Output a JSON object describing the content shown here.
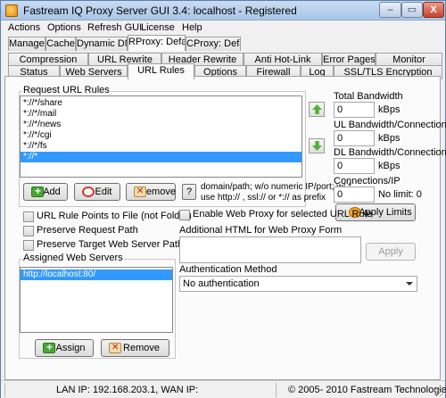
{
  "window": {
    "title": "Fastream IQ Proxy Server GUI 3.4: localhost - Registered",
    "min_label": "–",
    "max_label": "▭",
    "close_label": "X"
  },
  "menu": [
    {
      "label": "Actions"
    },
    {
      "label": "Options"
    },
    {
      "label": "Refresh GUI"
    },
    {
      "label": "License"
    },
    {
      "label": "Help"
    }
  ],
  "top_tabs": [
    {
      "label": "Manager"
    },
    {
      "label": "Cache"
    },
    {
      "label": "Dynamic DNS"
    },
    {
      "label": "RProxy: Default",
      "active": true
    },
    {
      "label": "CProxy: Default"
    }
  ],
  "sub_tabs_row1": [
    {
      "label": "Compression"
    },
    {
      "label": "URL Rewrite"
    },
    {
      "label": "Header Rewrite"
    },
    {
      "label": "Anti Hot-Link"
    },
    {
      "label": "Error Pages"
    },
    {
      "label": "Monitor"
    }
  ],
  "sub_tabs_row2": [
    {
      "label": "Status"
    },
    {
      "label": "Web Servers"
    },
    {
      "label": "URL Rules",
      "active": true
    },
    {
      "label": "Options"
    },
    {
      "label": "Firewall"
    },
    {
      "label": "Log"
    },
    {
      "label": "SSL/TLS Encryption"
    }
  ],
  "request_rules": {
    "group_label": "Request URL Rules",
    "items": [
      {
        "label": "*://*/share"
      },
      {
        "label": "*://*/mail"
      },
      {
        "label": "*://*/news"
      },
      {
        "label": "*://*/cgi"
      },
      {
        "label": "*://*/fs"
      },
      {
        "label": "*://*",
        "selected": true
      }
    ],
    "add_label": "Add",
    "edit_label": "Edit",
    "remove_label": "Remove",
    "help_label": "?",
    "hint_line1": "domain/path; w/o numeric IP/port; w/ *",
    "hint_line2": "use http:// , ssl:// or *:// as prefix"
  },
  "bandwidth": {
    "total_label": "Total Bandwidth",
    "total_value": "0",
    "total_unit": "kBps",
    "ul_label": "UL Bandwidth/Connection",
    "ul_value": "0",
    "ul_unit": "kBps",
    "dl_label": "DL Bandwidth/Connection",
    "dl_value": "0",
    "dl_unit": "kBps",
    "conn_label": "Connections/IP",
    "conn_value": "0",
    "conn_note": "No limit: 0",
    "apply_label": "Apply Limits"
  },
  "options": {
    "points_to_file": "URL Rule Points to File (not Folder)",
    "preserve_request_path": "Preserve Request Path",
    "preserve_target_path": "Preserve Target Web Server Path",
    "enable_web_proxy": "Enable Web Proxy for selected URL Rule",
    "additional_html_label": "Additional HTML for Web Proxy Form",
    "additional_html_value": "",
    "apply_label": "Apply",
    "auth_label": "Authentication Method",
    "auth_value": "No authentication"
  },
  "assigned_servers": {
    "group_label": "Assigned Web Servers",
    "items": [
      {
        "label": "http://localhost:80/",
        "selected": true
      }
    ],
    "assign_label": "Assign",
    "remove_label": "Remove"
  },
  "status": {
    "ip_text": "LAN IP: 192.168.203.1, WAN IP:",
    "copyright": "© 2005- 2010 Fastream Technologies"
  },
  "colors": {
    "selection": "#3399ff",
    "title_gradient_top": "#c9dcf2",
    "title_gradient_bottom": "#a9c5e8"
  }
}
